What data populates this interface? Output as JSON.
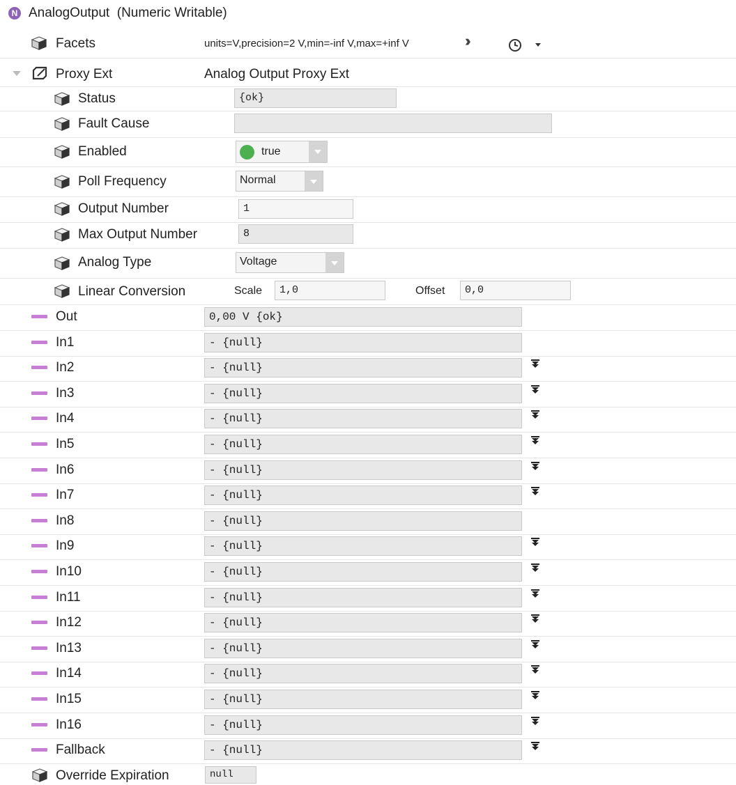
{
  "header": {
    "badge": "N",
    "title": "AnalogOutput  (Numeric Writable)"
  },
  "facets": {
    "label": "Facets",
    "value": "units=V,precision=2 V,min=-inf V,max=+inf V"
  },
  "proxy_ext": {
    "label": "Proxy Ext",
    "value": "Analog Output Proxy Ext",
    "status": {
      "label": "Status",
      "value": "{ok}"
    },
    "fault_cause": {
      "label": "Fault Cause",
      "value": ""
    },
    "enabled": {
      "label": "Enabled",
      "value": "true",
      "indicator_color": "#4caf50"
    },
    "poll_frequency": {
      "label": "Poll Frequency",
      "value": "Normal"
    },
    "output_number": {
      "label": "Output Number",
      "value": "1"
    },
    "max_output_number": {
      "label": "Max Output Number",
      "value": "8"
    },
    "analog_type": {
      "label": "Analog Type",
      "value": "Voltage"
    },
    "linear_conversion": {
      "label": "Linear Conversion",
      "scale_label": "Scale",
      "scale_value": "1,0",
      "offset_label": "Offset",
      "offset_value": "0,0"
    }
  },
  "slots": [
    {
      "label": "Out",
      "value": "0,00 V {ok}",
      "priority_arrow": false
    },
    {
      "label": "In1",
      "value": "- {null}",
      "priority_arrow": false
    },
    {
      "label": "In2",
      "value": "- {null}",
      "priority_arrow": true
    },
    {
      "label": "In3",
      "value": "- {null}",
      "priority_arrow": true
    },
    {
      "label": "In4",
      "value": "- {null}",
      "priority_arrow": true
    },
    {
      "label": "In5",
      "value": "- {null}",
      "priority_arrow": true
    },
    {
      "label": "In6",
      "value": "- {null}",
      "priority_arrow": true
    },
    {
      "label": "In7",
      "value": "- {null}",
      "priority_arrow": true
    },
    {
      "label": "In8",
      "value": "- {null}",
      "priority_arrow": false
    },
    {
      "label": "In9",
      "value": "- {null}",
      "priority_arrow": true
    },
    {
      "label": "In10",
      "value": "- {null}",
      "priority_arrow": true
    },
    {
      "label": "In11",
      "value": "- {null}",
      "priority_arrow": true
    },
    {
      "label": "In12",
      "value": "- {null}",
      "priority_arrow": true
    },
    {
      "label": "In13",
      "value": "- {null}",
      "priority_arrow": true
    },
    {
      "label": "In14",
      "value": "- {null}",
      "priority_arrow": true
    },
    {
      "label": "In15",
      "value": "- {null}",
      "priority_arrow": true
    },
    {
      "label": "In16",
      "value": "- {null}",
      "priority_arrow": true
    },
    {
      "label": "Fallback",
      "value": "- {null}",
      "priority_arrow": true
    }
  ],
  "override_expiration": {
    "label": "Override Expiration",
    "value": "null"
  },
  "icons": {
    "facets_more": "double-chevron-right-icon",
    "history": "clock-icon",
    "priority": "down-arrow-bar-icon"
  },
  "colors": {
    "slot_dash": "#c77fd6",
    "badge": "#8d63b8",
    "enabled_indicator": "#4caf50"
  }
}
